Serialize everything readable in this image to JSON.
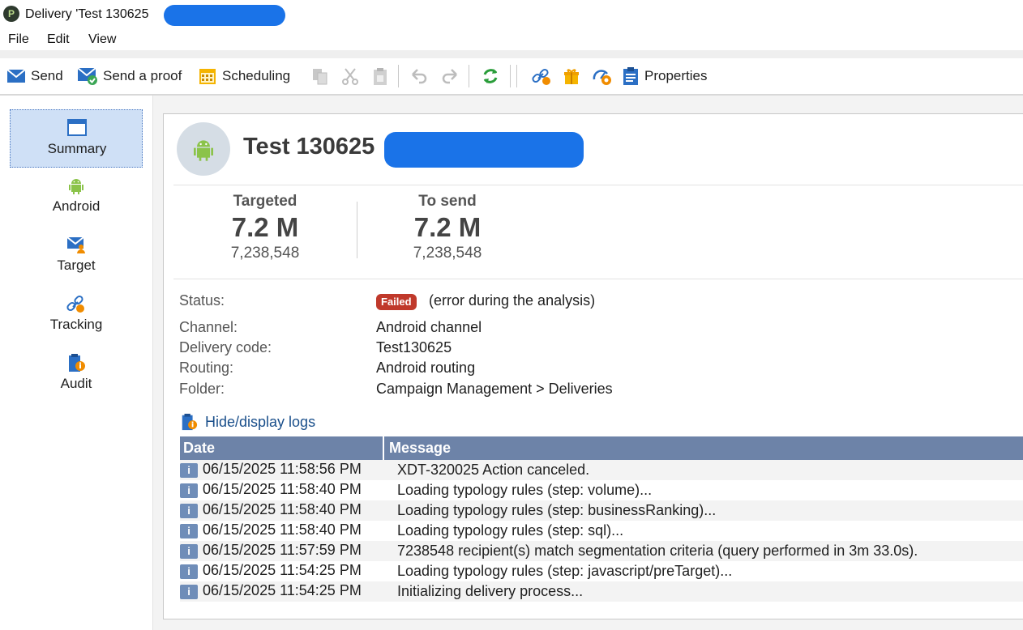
{
  "window": {
    "title": "Delivery 'Test 130625"
  },
  "menu": [
    "File",
    "Edit",
    "View"
  ],
  "toolbar": {
    "send_label": "Send",
    "proof_label": "Send a proof",
    "scheduling_label": "Scheduling",
    "properties_label": "Properties"
  },
  "sidebar": {
    "items": [
      {
        "label": "Summary",
        "icon": "window-icon"
      },
      {
        "label": "Android",
        "icon": "android-icon"
      },
      {
        "label": "Target",
        "icon": "target-icon"
      },
      {
        "label": "Tracking",
        "icon": "tracking-icon"
      },
      {
        "label": "Audit",
        "icon": "audit-icon"
      }
    ]
  },
  "delivery": {
    "title": "Test 130625",
    "kpis": [
      {
        "label": "Targeted",
        "value": "7.2 M",
        "exact": "7,238,548"
      },
      {
        "label": "To send",
        "value": "7.2 M",
        "exact": "7,238,548"
      }
    ],
    "status_label": "Status:",
    "status_badge": "Failed",
    "status_note": "(error during the analysis)",
    "status_color": "#c0392b",
    "fields": [
      {
        "label": "Channel:",
        "value": "Android channel"
      },
      {
        "label": "Delivery code:",
        "value": "Test130625"
      },
      {
        "label": "Routing:",
        "value": "Android routing"
      },
      {
        "label": "Folder:",
        "value": "Campaign Management > Deliveries"
      }
    ]
  },
  "logs": {
    "toggle_label": "Hide/display logs",
    "col_date": "Date",
    "col_message": "Message",
    "rows": [
      {
        "date": "06/15/2025 11:58:56 PM",
        "message": "XDT-320025 Action canceled."
      },
      {
        "date": "06/15/2025 11:58:40 PM",
        "message": "Loading typology rules (step: volume)..."
      },
      {
        "date": "06/15/2025 11:58:40 PM",
        "message": "Loading typology rules (step: businessRanking)..."
      },
      {
        "date": "06/15/2025 11:58:40 PM",
        "message": "Loading typology rules (step: sql)..."
      },
      {
        "date": "06/15/2025 11:57:59 PM",
        "message": "7238548 recipient(s) match segmentation criteria (query performed in 3m 33.0s)."
      },
      {
        "date": "06/15/2025 11:54:25 PM",
        "message": "Loading typology rules (step: javascript/preTarget)..."
      },
      {
        "date": "06/15/2025 11:54:25 PM",
        "message": "Initializing delivery process..."
      }
    ]
  },
  "colors": {
    "accent": "#1a4f8b",
    "log_header": "#6d83a8",
    "android_green": "#8bc34a",
    "redaction": "#1a73e8"
  }
}
